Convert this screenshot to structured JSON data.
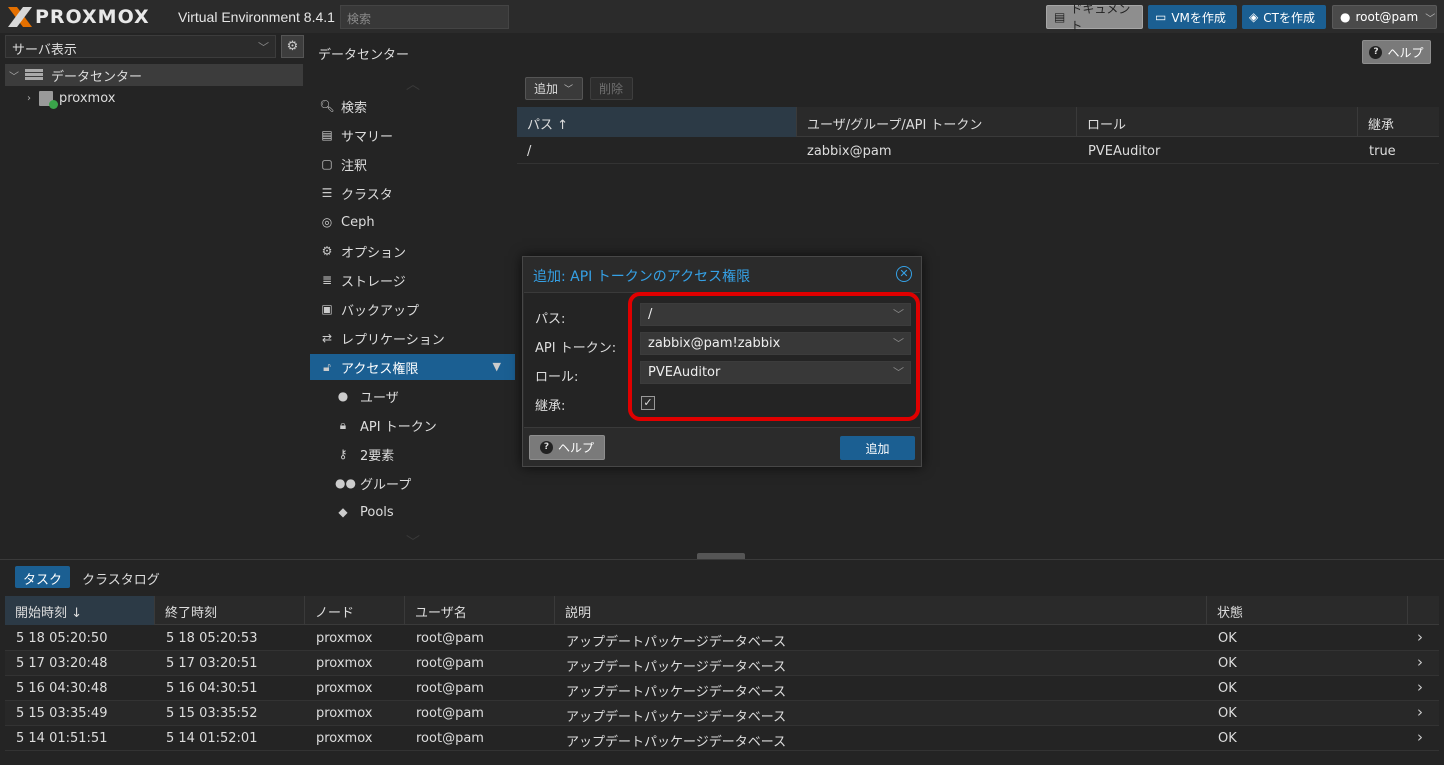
{
  "header": {
    "logo_text": "PROXMOX",
    "version": "Virtual Environment 8.4.1",
    "search_placeholder": "検索",
    "docs_label": "ドキュメント",
    "create_vm_label": "VMを作成",
    "create_ct_label": "CTを作成",
    "user_label": "root@pam"
  },
  "sidebar": {
    "view_label": "サーバ表示",
    "tree": {
      "datacenter": "データセンター",
      "node": "proxmox"
    }
  },
  "center": {
    "title": "データセンター",
    "help_label": "ヘルプ"
  },
  "nav": {
    "items": [
      {
        "label": "検索",
        "icon": "search-icon"
      },
      {
        "label": "サマリー",
        "icon": "book-icon"
      },
      {
        "label": "注釈",
        "icon": "note-icon"
      },
      {
        "label": "クラスタ",
        "icon": "server-icon"
      },
      {
        "label": "Ceph",
        "icon": "ceph-icon"
      },
      {
        "label": "オプション",
        "icon": "gear-icon"
      },
      {
        "label": "ストレージ",
        "icon": "database-icon"
      },
      {
        "label": "バックアップ",
        "icon": "floppy-icon"
      },
      {
        "label": "レプリケーション",
        "icon": "retweet-icon"
      },
      {
        "label": "アクセス権限",
        "icon": "unlock-icon"
      },
      {
        "label": "ユーザ",
        "icon": "user-icon"
      },
      {
        "label": "API トークン",
        "icon": "lock-icon"
      },
      {
        "label": "2要素",
        "icon": "key-icon"
      },
      {
        "label": "グループ",
        "icon": "users-icon"
      },
      {
        "label": "Pools",
        "icon": "tags-icon"
      }
    ]
  },
  "permissions": {
    "add_label": "追加",
    "delete_label": "削除",
    "columns": [
      "パス ↑",
      "ユーザ/グループ/API トークン",
      "ロール",
      "継承"
    ],
    "rows": [
      {
        "path": "/",
        "user": "zabbix@pam",
        "role": "PVEAuditor",
        "propagate": "true"
      }
    ]
  },
  "dialog": {
    "title": "追加: API トークンのアクセス権限",
    "path_label": "パス:",
    "path_value": "/",
    "token_label": "API トークン:",
    "token_value": "zabbix@pam!zabbix",
    "role_label": "ロール:",
    "role_value": "PVEAuditor",
    "propagate_label": "継承:",
    "propagate_checked": true,
    "help_label": "ヘルプ",
    "add_label": "追加"
  },
  "log": {
    "tabs": [
      "タスク",
      "クラスタログ"
    ],
    "columns": [
      "開始時刻 ↓",
      "終了時刻",
      "ノード",
      "ユーザ名",
      "説明",
      "状態"
    ],
    "rows": [
      {
        "start": "5 18 05:20:50",
        "end": "5 18 05:20:53",
        "node": "proxmox",
        "user": "root@pam",
        "desc": "アップデートパッケージデータベース",
        "status": "OK"
      },
      {
        "start": "5 17 03:20:48",
        "end": "5 17 03:20:51",
        "node": "proxmox",
        "user": "root@pam",
        "desc": "アップデートパッケージデータベース",
        "status": "OK"
      },
      {
        "start": "5 16 04:30:48",
        "end": "5 16 04:30:51",
        "node": "proxmox",
        "user": "root@pam",
        "desc": "アップデートパッケージデータベース",
        "status": "OK"
      },
      {
        "start": "5 15 03:35:49",
        "end": "5 15 03:35:52",
        "node": "proxmox",
        "user": "root@pam",
        "desc": "アップデートパッケージデータベース",
        "status": "OK"
      },
      {
        "start": "5 14 01:51:51",
        "end": "5 14 01:52:01",
        "node": "proxmox",
        "user": "root@pam",
        "desc": "アップデートパッケージデータベース",
        "status": "OK"
      }
    ]
  },
  "colors": {
    "accent": "#1b5f92",
    "dialog_title": "#35a1e6",
    "highlight": "#e00000"
  }
}
